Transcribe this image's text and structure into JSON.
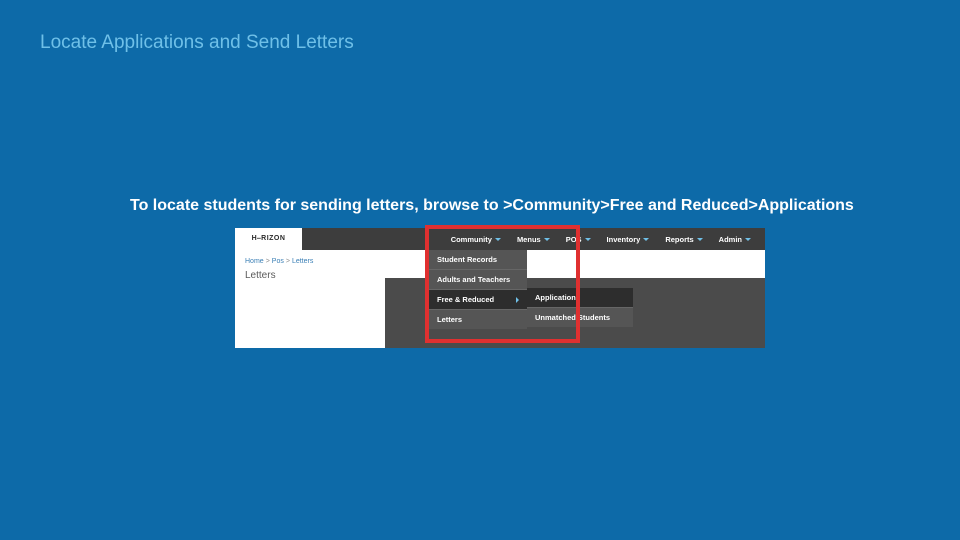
{
  "title": "Locate Applications and Send Letters",
  "body": "To locate students for sending letters, browse to >Community>Free and Reduced>Applications",
  "embed": {
    "logo": "H⎯RIZON",
    "menu": [
      "Community",
      "Menus",
      "POS",
      "Inventory",
      "Reports",
      "Admin"
    ],
    "crumbs": [
      "Home",
      "Pos",
      "Letters"
    ],
    "heading": "Letters",
    "dd1": [
      "Student Records",
      "Adults and Teachers",
      "Free & Reduced",
      "Letters"
    ],
    "dd2": [
      "Applications",
      "Unmatched Students"
    ]
  }
}
